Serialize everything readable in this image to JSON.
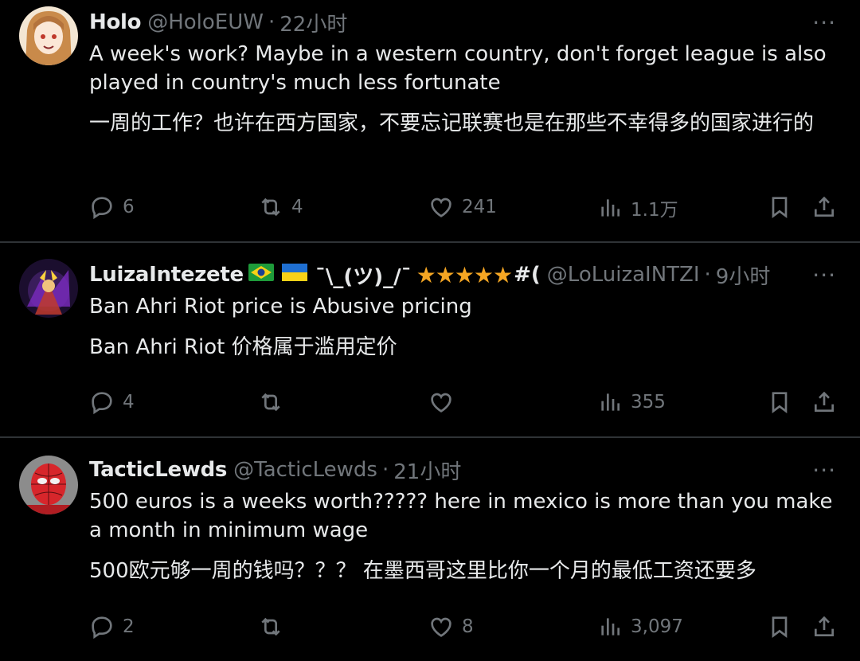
{
  "tweets": [
    {
      "name": "Holo",
      "handle": "@HoloEUW",
      "time": "22小时",
      "text_en": "A week's work? Maybe in a western country, don't forget league is also played in country's much less fortunate",
      "text_zh": "一周的工作？也许在西方国家，不要忘记联赛也是在那些不幸得多的国家进行的",
      "replies": "6",
      "retweets": "4",
      "likes": "241",
      "views": "1.1万"
    },
    {
      "name": "LuizaIntezete",
      "name_extra": "¯\\_(ツ)_/¯",
      "name_stars": "★★★★★",
      "name_hash": "#(",
      "handle": "@LoLuizaINTZI",
      "time": "9小时",
      "text_en": "Ban Ahri Riot price is Abusive pricing",
      "text_zh": "Ban Ahri Riot 价格属于滥用定价",
      "replies": "4",
      "retweets": "",
      "likes": "",
      "views": "355"
    },
    {
      "name": "TacticLewds",
      "handle": "@TacticLewds",
      "time": "21小时",
      "text_en": "500 euros is a weeks worth????? here in mexico is more than you make a month in minimum wage",
      "text_zh": "500欧元够一周的钱吗？？？ 在墨西哥这里比你一个月的最低工资还要多",
      "replies": "2",
      "retweets": "",
      "likes": "8",
      "views": "3,097"
    }
  ],
  "separator": "·",
  "more_label": "···",
  "icons": [
    "reply-icon",
    "retweet-icon",
    "like-icon",
    "views-icon",
    "bookmark-icon",
    "share-icon",
    "more-icon"
  ],
  "colors": {
    "background": "#000000",
    "text": "#e7e9ea",
    "secondary": "#71767b",
    "divider": "#2f3336",
    "stars": "#f5a623"
  }
}
